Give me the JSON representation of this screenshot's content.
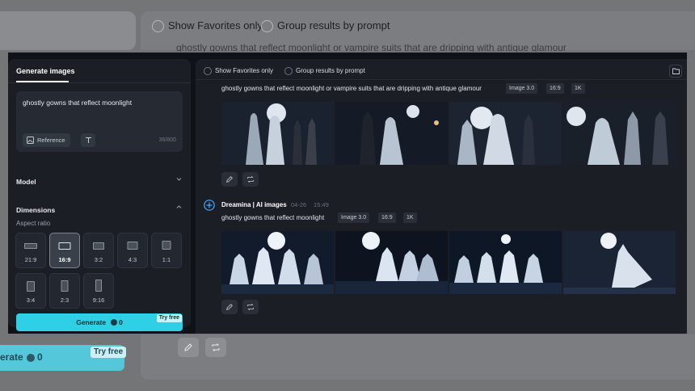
{
  "background": {
    "show_favorites_label": "Show Favorites only",
    "group_results_label": "Group results by prompt",
    "blurred_prompt": "ghostly gowns that reflect moonlight or vampire suits that are dripping with antique glamour",
    "generate_label": "erate",
    "credits": "0",
    "try_free": "Try free"
  },
  "sidebar": {
    "tab_label": "Generate images",
    "prompt_value": "ghostly gowns that reflect moonlight",
    "reference_label": "Reference",
    "char_count": "36/800",
    "model_label": "Model",
    "dimensions_label": "Dimensions",
    "aspect_ratio_label": "Aspect ratio",
    "ratios": [
      "21:9",
      "16:9",
      "3:2",
      "4:3",
      "1:1",
      "3:4",
      "2:3",
      "9:16"
    ],
    "selected_ratio": "16:9",
    "generate_label": "Generate",
    "credits": "0",
    "try_free": "Try free"
  },
  "main": {
    "show_favorites_label": "Show Favorites only",
    "group_results_label": "Group results by prompt",
    "results": [
      {
        "prompt": "ghostly gowns that reflect moonlight or vampire suits that are dripping with antique glamour",
        "tags": [
          "Image 3.0",
          "16:9",
          "1K"
        ]
      },
      {
        "author": "Dreamina | AI images",
        "date": "04-26",
        "time": "15:49",
        "prompt": "ghostly gowns that reflect moonlight",
        "tags": [
          "Image 3.0",
          "16:9",
          "1K"
        ]
      }
    ]
  },
  "colors": {
    "accent": "#2fd0e6",
    "panel": "#1b1f25",
    "window": "#0f1216"
  }
}
